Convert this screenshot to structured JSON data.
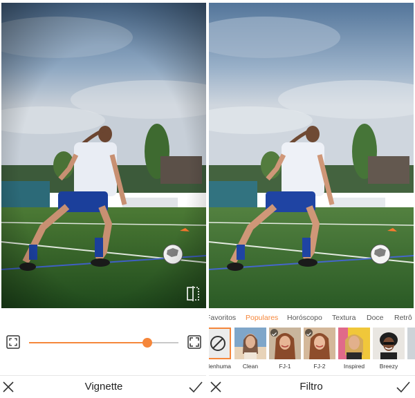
{
  "left_panel": {
    "tool_title": "Vignette",
    "slider": {
      "value_percent": 79
    }
  },
  "right_panel": {
    "tool_title": "Filtro",
    "tabs": [
      {
        "label": "Favoritos"
      },
      {
        "label": "Populares",
        "active": true
      },
      {
        "label": "Horóscopo"
      },
      {
        "label": "Textura"
      },
      {
        "label": "Doce"
      },
      {
        "label": "Retrô"
      }
    ],
    "filters": [
      {
        "label": "Nenhuma",
        "icon": "no-filter-icon",
        "selected": true
      },
      {
        "label": "Clean"
      },
      {
        "label": "FJ-1",
        "favorite": true
      },
      {
        "label": "FJ-2",
        "favorite": true
      },
      {
        "label": "Inspired"
      },
      {
        "label": "Breezy"
      }
    ]
  },
  "colors": {
    "accent": "#f5863a",
    "text": "#222222"
  }
}
